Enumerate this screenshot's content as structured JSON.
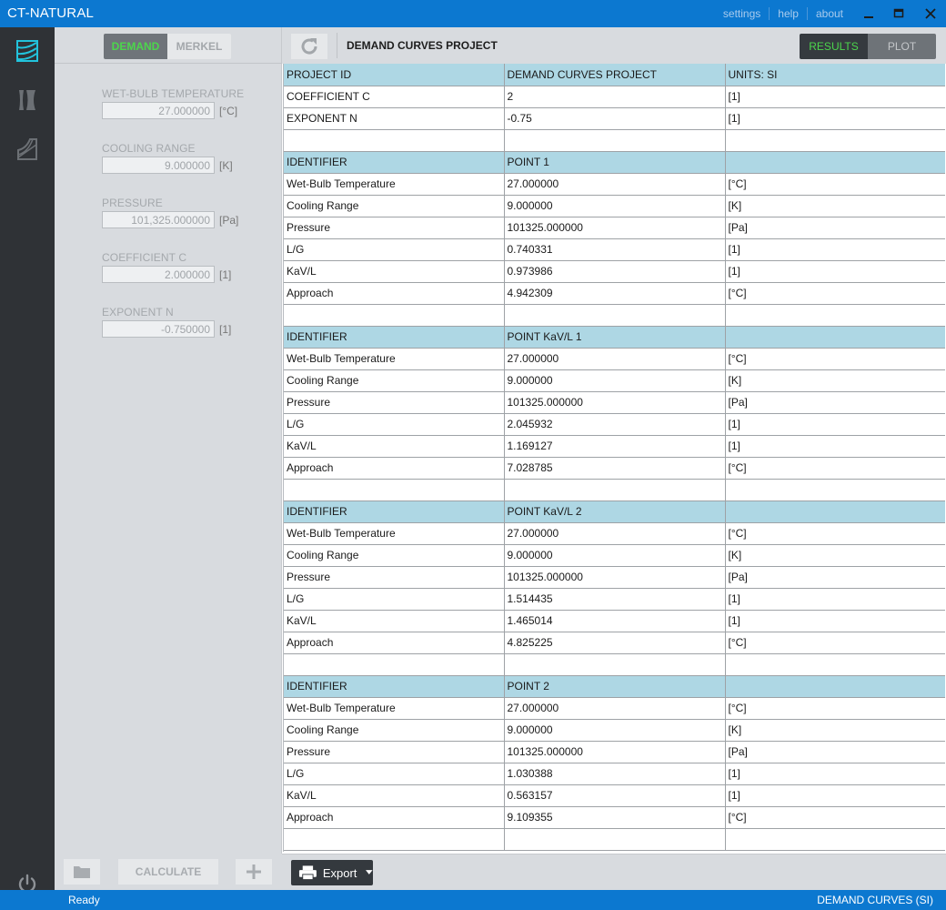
{
  "window": {
    "title": "CT-NATURAL",
    "links": [
      "settings",
      "help",
      "about"
    ]
  },
  "sidebar": {
    "items": [
      "demand-curves-icon",
      "tower-icon",
      "tower-profile-icon"
    ],
    "power": "power-icon"
  },
  "left_panel": {
    "mode_tabs": {
      "demand": "DEMAND",
      "merkel": "MERKEL",
      "active": "DEMAND"
    },
    "fields": [
      {
        "label": "WET-BULB TEMPERATURE",
        "value": "27.000000",
        "unit": "[°C]"
      },
      {
        "label": "COOLING RANGE",
        "value": "9.000000",
        "unit": "[K]"
      },
      {
        "label": "PRESSURE",
        "value": "101,325.000000",
        "unit": "[Pa]"
      },
      {
        "label": "COEFFICIENT C",
        "value": "2.000000",
        "unit": "[1]"
      },
      {
        "label": "EXPONENT N",
        "value": "-0.750000",
        "unit": "[1]"
      }
    ],
    "bottom": {
      "calculate": "CALCULATE"
    }
  },
  "toolbar": {
    "project_title": "DEMAND CURVES PROJECT",
    "view_tabs": {
      "results": "RESULTS",
      "plot": "PLOT",
      "active": "RESULTS"
    }
  },
  "table": {
    "rows": [
      {
        "type": "hdr",
        "cells": [
          "PROJECT ID",
          "DEMAND CURVES PROJECT",
          "UNITS: SI"
        ]
      },
      {
        "type": "row",
        "cells": [
          "COEFFICIENT C",
          "2",
          "[1]"
        ]
      },
      {
        "type": "row",
        "cells": [
          "EXPONENT N",
          "-0.75",
          "[1]"
        ]
      },
      {
        "type": "row",
        "cells": [
          "",
          "",
          ""
        ]
      },
      {
        "type": "hdr",
        "cells": [
          "IDENTIFIER",
          "POINT 1",
          ""
        ]
      },
      {
        "type": "row",
        "cells": [
          "Wet-Bulb Temperature",
          "27.000000",
          "[°C]"
        ]
      },
      {
        "type": "row",
        "cells": [
          "Cooling Range",
          "9.000000",
          "[K]"
        ]
      },
      {
        "type": "row",
        "cells": [
          "Pressure",
          "101325.000000",
          "[Pa]"
        ]
      },
      {
        "type": "row",
        "cells": [
          "L/G",
          "0.740331",
          "[1]"
        ]
      },
      {
        "type": "row",
        "cells": [
          "KaV/L",
          "0.973986",
          "[1]"
        ]
      },
      {
        "type": "row",
        "cells": [
          "Approach",
          "4.942309",
          "[°C]"
        ]
      },
      {
        "type": "row",
        "cells": [
          "",
          "",
          ""
        ]
      },
      {
        "type": "hdr",
        "cells": [
          "IDENTIFIER",
          "POINT KaV/L 1",
          ""
        ]
      },
      {
        "type": "row",
        "cells": [
          "Wet-Bulb Temperature",
          "27.000000",
          "[°C]"
        ]
      },
      {
        "type": "row",
        "cells": [
          "Cooling Range",
          "9.000000",
          "[K]"
        ]
      },
      {
        "type": "row",
        "cells": [
          "Pressure",
          "101325.000000",
          "[Pa]"
        ]
      },
      {
        "type": "row",
        "cells": [
          "L/G",
          "2.045932",
          "[1]"
        ]
      },
      {
        "type": "row",
        "cells": [
          "KaV/L",
          "1.169127",
          "[1]"
        ]
      },
      {
        "type": "row",
        "cells": [
          "Approach",
          "7.028785",
          "[°C]"
        ]
      },
      {
        "type": "row",
        "cells": [
          "",
          "",
          ""
        ]
      },
      {
        "type": "hdr",
        "cells": [
          "IDENTIFIER",
          "POINT KaV/L 2",
          ""
        ]
      },
      {
        "type": "row",
        "cells": [
          "Wet-Bulb Temperature",
          "27.000000",
          "[°C]"
        ]
      },
      {
        "type": "row",
        "cells": [
          "Cooling Range",
          "9.000000",
          "[K]"
        ]
      },
      {
        "type": "row",
        "cells": [
          "Pressure",
          "101325.000000",
          "[Pa]"
        ]
      },
      {
        "type": "row",
        "cells": [
          "L/G",
          "1.514435",
          "[1]"
        ]
      },
      {
        "type": "row",
        "cells": [
          "KaV/L",
          "1.465014",
          "[1]"
        ]
      },
      {
        "type": "row",
        "cells": [
          "Approach",
          "4.825225",
          "[°C]"
        ]
      },
      {
        "type": "row",
        "cells": [
          "",
          "",
          ""
        ]
      },
      {
        "type": "hdr",
        "cells": [
          "IDENTIFIER",
          "POINT 2",
          ""
        ]
      },
      {
        "type": "row",
        "cells": [
          "Wet-Bulb Temperature",
          "27.000000",
          "[°C]"
        ]
      },
      {
        "type": "row",
        "cells": [
          "Cooling Range",
          "9.000000",
          "[K]"
        ]
      },
      {
        "type": "row",
        "cells": [
          "Pressure",
          "101325.000000",
          "[Pa]"
        ]
      },
      {
        "type": "row",
        "cells": [
          "L/G",
          "1.030388",
          "[1]"
        ]
      },
      {
        "type": "row",
        "cells": [
          "KaV/L",
          "0.563157",
          "[1]"
        ]
      },
      {
        "type": "row",
        "cells": [
          "Approach",
          "9.109355",
          "[°C]"
        ]
      },
      {
        "type": "row",
        "cells": [
          "",
          "",
          ""
        ]
      }
    ]
  },
  "bottom_toolbar": {
    "export": "Export"
  },
  "status": {
    "left": "Ready",
    "right": "DEMAND CURVES (SI)"
  },
  "colors": {
    "accent": "#0c78d0",
    "sidebar": "#2f3236",
    "panel": "#d8dbdf",
    "table_header": "#aed7e4",
    "active_text": "#4cd64c",
    "icon_active": "#22c3dc"
  }
}
